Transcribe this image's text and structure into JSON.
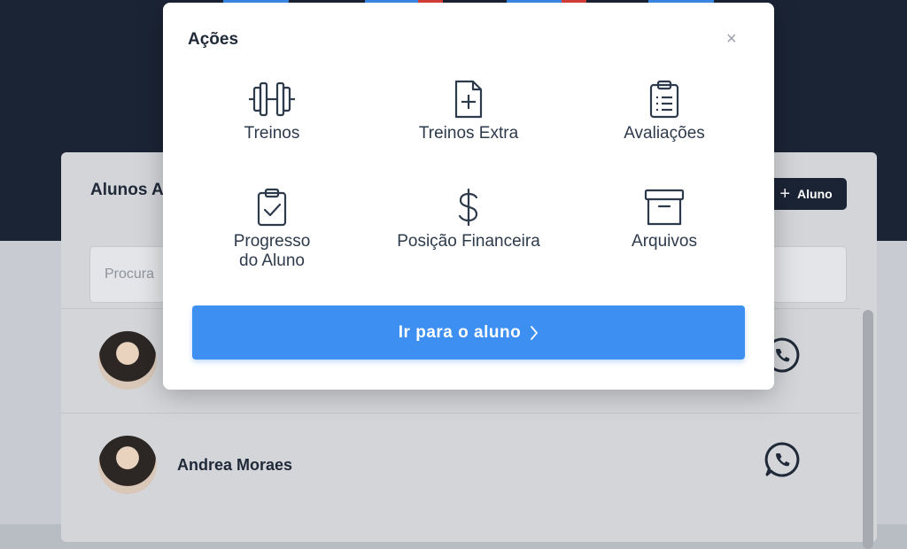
{
  "background_list": {
    "title": "Alunos A",
    "add_button_label": "Aluno",
    "search_placeholder": "Procura",
    "students": [
      {
        "name": ""
      },
      {
        "name": "Andrea Moraes"
      }
    ]
  },
  "modal": {
    "title": "Ações",
    "close_symbol": "×",
    "actions": [
      {
        "label": "Treinos",
        "icon": "dumbbell-icon"
      },
      {
        "label": "Treinos Extra",
        "icon": "file-plus-icon"
      },
      {
        "label": "Avaliações",
        "icon": "clipboard-list-icon"
      },
      {
        "label": "Progresso\ndo Aluno",
        "icon": "clipboard-check-icon"
      },
      {
        "label": "Posição Financeira",
        "icon": "dollar-icon"
      },
      {
        "label": "Arquivos",
        "icon": "archive-icon"
      }
    ],
    "go_button_label": "Ir para o aluno"
  },
  "colors": {
    "topbar": "#1b2435",
    "primary_button": "#3d8ff2",
    "text": "#2d3a4b"
  }
}
